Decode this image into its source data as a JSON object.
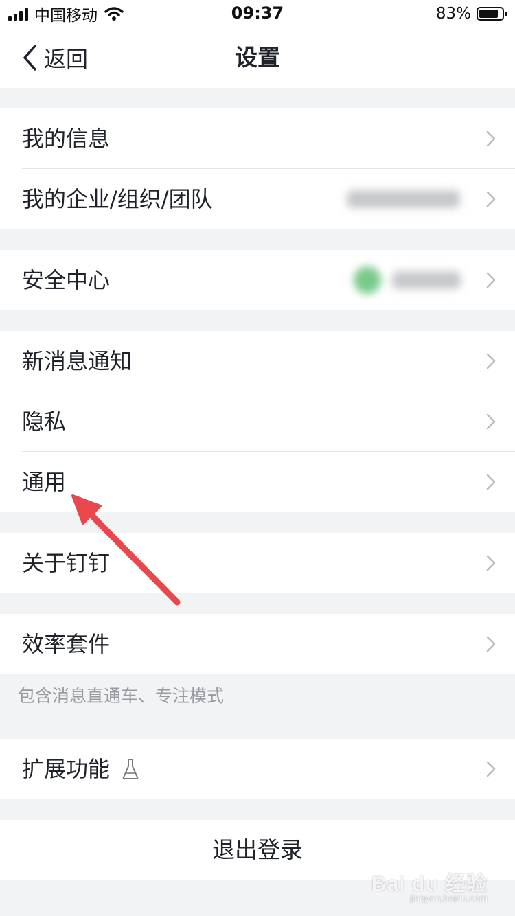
{
  "status_bar": {
    "carrier": "中国移动",
    "time": "09:37",
    "battery": "83%",
    "battery_level": 0.83
  },
  "nav": {
    "back_label": "返回",
    "title": "设置"
  },
  "settings": {
    "my_info": "我的信息",
    "my_org": "我的企业/组织/团队",
    "security_center": "安全中心",
    "new_message_notification": "新消息通知",
    "privacy": "隐私",
    "general": "通用",
    "about": "关于钉钉",
    "efficiency_suite": "效率套件",
    "efficiency_hint": "包含消息直通车、专注模式",
    "extensions": "扩展功能",
    "logout": "退出登录"
  },
  "icons": {
    "back": "chevron-left-icon",
    "row_arrow": "chevron-right-icon",
    "extensions": "flask-icon"
  },
  "colors": {
    "background": "#f2f3f5",
    "row": "#ffffff",
    "text": "#1f2329",
    "hint": "#999aa0",
    "chevron": "#b9bbbe",
    "annotation_arrow": "#e8474e"
  },
  "watermark": {
    "brand": "Bai du 经验",
    "url": "jingyan.baidu.com"
  }
}
